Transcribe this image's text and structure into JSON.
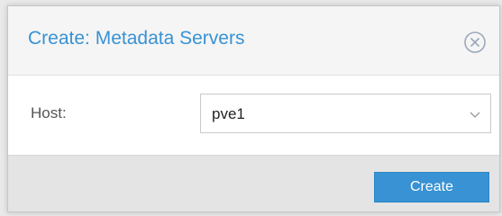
{
  "dialog": {
    "title": "Create: Metadata Servers",
    "close_icon": "close-circle-icon"
  },
  "form": {
    "host_label": "Host:",
    "host_value": "pve1",
    "host_trigger_icon": "chevron-down-icon"
  },
  "footer": {
    "create_label": "Create"
  },
  "colors": {
    "accent": "#3892d4",
    "header_bg": "#f5f5f5",
    "footer_bg": "#e4e4e4"
  }
}
